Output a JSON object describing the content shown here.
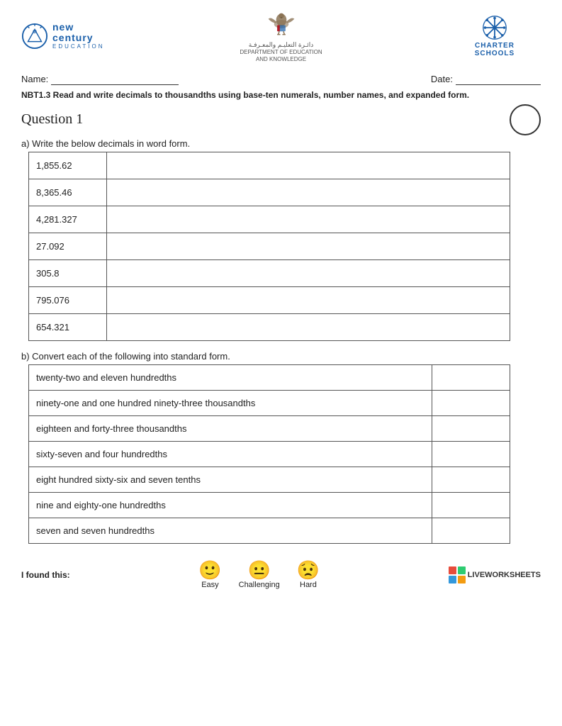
{
  "header": {
    "nc_new": "new",
    "nc_century": "century",
    "nc_education": "EDUCATION",
    "arabic_text": "دائـرة التعليـم والمعـرفـة",
    "dept_line1": "DEPARTMENT OF EDUCATION",
    "dept_line2": "AND KNOWLEDGE",
    "charter_line1": "CHARTER",
    "charter_line2": "SCHOOLS"
  },
  "name_date": {
    "name_label": "Name:",
    "date_label": "Date:"
  },
  "instruction": {
    "code": "NBT1.3",
    "text": " Read and write decimals to thousandths using base-ten numerals, number names, and expanded form."
  },
  "question": {
    "title": "Question 1",
    "part_a_label": "a) Write the below decimals in word form.",
    "part_b_label": "b) Convert each of the following into standard form.",
    "decimals": [
      "1,855.62",
      "8,365.46",
      "4,281.327",
      "27.092",
      "305.8",
      "795.076",
      "654.321"
    ],
    "word_forms": [
      "twenty-two and eleven hundredths",
      "ninety-one and one hundred ninety-three thousandths",
      "eighteen and forty-three thousandths",
      "sixty-seven and four hundredths",
      "eight hundred sixty-six and seven tenths",
      "nine and eighty-one hundredths",
      "seven and seven hundredths"
    ]
  },
  "footer": {
    "found_this_label": "I found this:",
    "emoji_easy": "Easy",
    "emoji_challenging": "Challenging",
    "emoji_hard": "Hard",
    "liveworksheets": "LIVEWORKSHEETS"
  }
}
